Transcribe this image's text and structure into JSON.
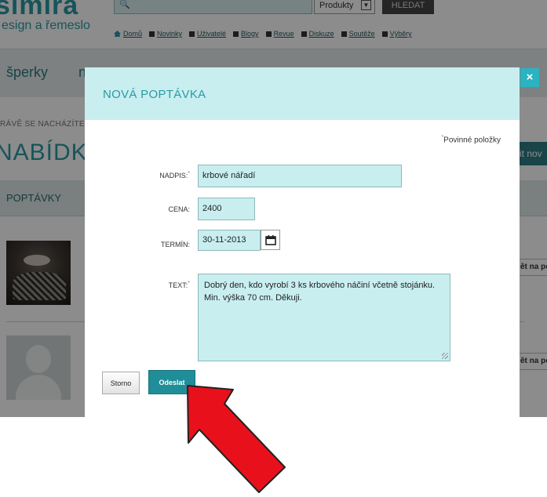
{
  "site": {
    "logo": "simira",
    "tagline": "esign a řemeslo",
    "search": {
      "placeholder": "",
      "category": "Produkty",
      "button": "HLEDAT"
    },
    "nav": [
      "Domů",
      "Novinky",
      "Uživatelé",
      "Blogy",
      "Revue",
      "Diskuze",
      "Soutěže",
      "Výběry"
    ],
    "categories": [
      "šperky",
      "n"
    ],
    "breadcrumb": "RÁVĚ SE NACHÁZÍTE",
    "section_title": "NABÍDKY",
    "add_button": "it nov",
    "tab": "POPTÁVKY",
    "rows": [
      {
        "side_link": "ět na po"
      },
      {
        "side_link": "ět na po"
      }
    ]
  },
  "modal": {
    "title": "NOVÁ POPTÁVKA",
    "close": "×",
    "required_note": "Povinné položky",
    "required_mark": "*",
    "fields": {
      "nadpis": {
        "label": "NADPIS:",
        "value": "krbové nářadí"
      },
      "cena": {
        "label": "CENA:",
        "value": "2400"
      },
      "termin": {
        "label": "TERMÍN:",
        "value": "30-11-2013"
      },
      "text": {
        "label": "TEXT:",
        "value": "Dobrý den, kdo vyrobí 3 ks krbového náčiní včetně stojánku. Min. výška 70 cm. Děkuji."
      }
    },
    "buttons": {
      "cancel": "Storno",
      "submit": "Odeslat"
    }
  },
  "annotation": {
    "arrow_color": "#e8111b"
  },
  "colors": {
    "accent": "#2a9aa3",
    "modal_header": "#c9eef0",
    "field_bg": "#c8eef0",
    "submit": "#1f8e98"
  }
}
